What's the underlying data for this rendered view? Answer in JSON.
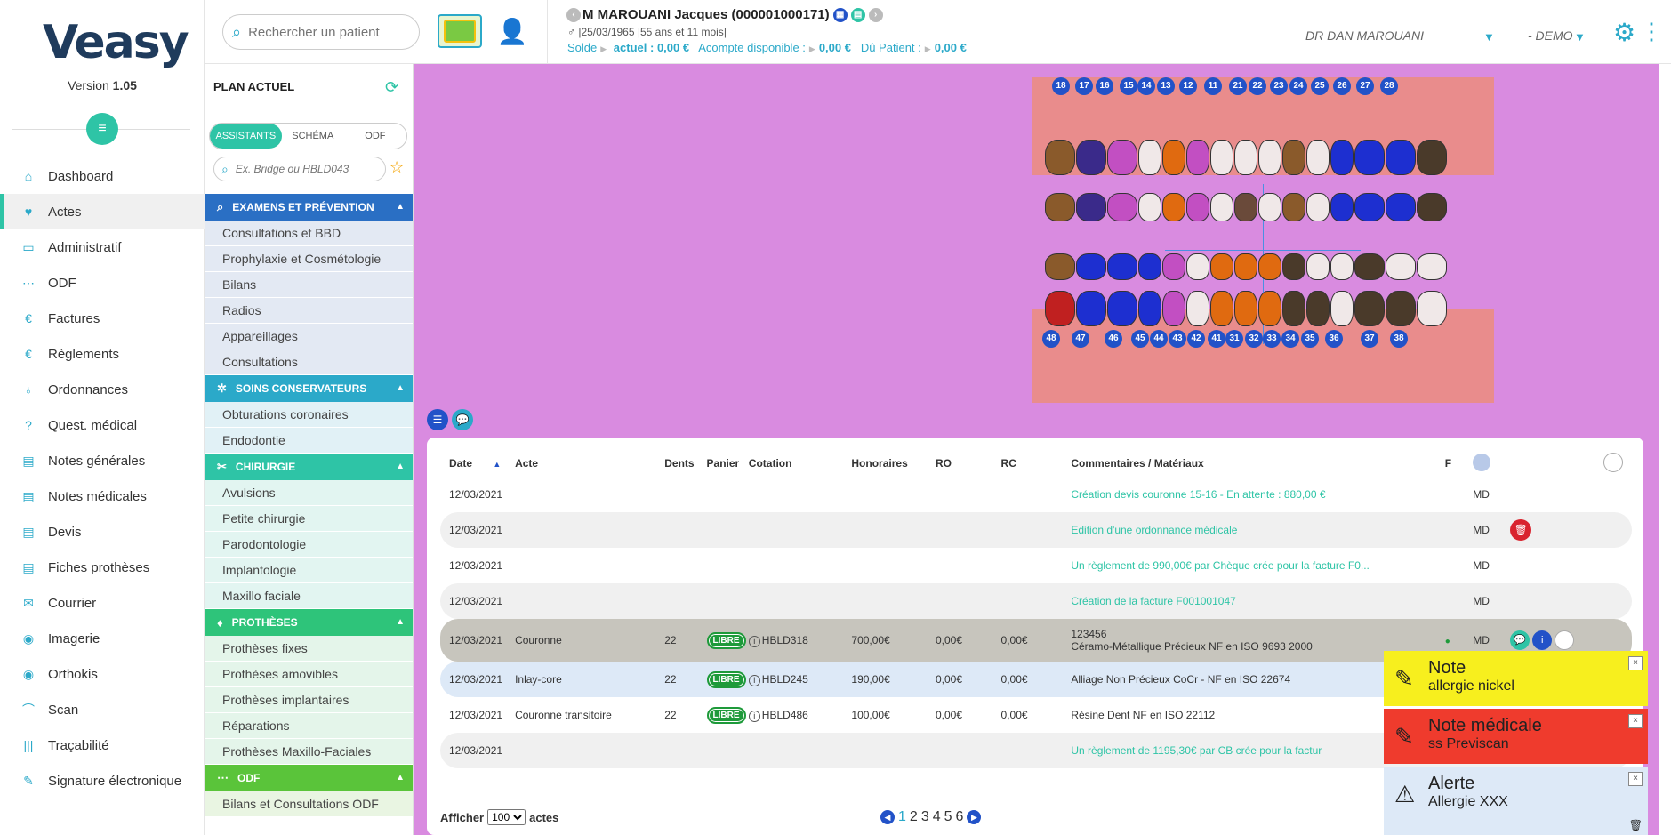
{
  "app": {
    "logo": "Veasy",
    "version_label": "Version",
    "version": "1.05"
  },
  "nav": [
    {
      "label": "Dashboard",
      "icon": "home-icon"
    },
    {
      "label": "Actes",
      "icon": "tooth-icon",
      "active": true
    },
    {
      "label": "Administratif",
      "icon": "id-card-icon"
    },
    {
      "label": "ODF",
      "icon": "braces-icon"
    },
    {
      "label": "Factures",
      "icon": "invoice-icon"
    },
    {
      "label": "Règlements",
      "icon": "euro-icon"
    },
    {
      "label": "Ordonnances",
      "icon": "stethoscope-icon"
    },
    {
      "label": "Quest. médical",
      "icon": "question-icon"
    },
    {
      "label": "Notes générales",
      "icon": "document-icon"
    },
    {
      "label": "Notes médicales",
      "icon": "document-icon"
    },
    {
      "label": "Devis",
      "icon": "document-icon"
    },
    {
      "label": "Fiches prothèses",
      "icon": "document-icon"
    },
    {
      "label": "Courrier",
      "icon": "envelope-icon"
    },
    {
      "label": "Imagerie",
      "icon": "camera-icon"
    },
    {
      "label": "Orthokis",
      "icon": "camera-icon"
    },
    {
      "label": "Scan",
      "icon": "scanner-icon"
    },
    {
      "label": "Traçabilité",
      "icon": "barcode-icon"
    },
    {
      "label": "Signature électronique",
      "icon": "edit-icon"
    }
  ],
  "topbar": {
    "search_placeholder": "Rechercher un patient",
    "patient_name": "M MAROUANI Jacques (000001000171)",
    "patient_birth": "25/03/1965",
    "patient_age": "55 ans et 11 mois",
    "solde_label": "Solde",
    "actuel_label": "actuel :",
    "actuel_value": "0,00 €",
    "acompte_label": "Acompte disponible :",
    "acompte_value": "0,00 €",
    "du_label": "Dû Patient :",
    "du_value": "0,00 €",
    "doctor": "DR DAN MAROUANI",
    "workspace": "- DEMO"
  },
  "plan": {
    "title": "PLAN ACTUEL",
    "tabs": [
      "ASSISTANTS",
      "SCHÉMA",
      "ODF"
    ],
    "search_placeholder": "Ex. Bridge ou HBLD043",
    "sections": [
      {
        "title": "EXAMENS ET PRÉVENTION",
        "icon": "search-icon",
        "color": "#2a6fc4",
        "items_bg": "#e3e9f3",
        "items": [
          "Consultations et BBD",
          "Prophylaxie et Cosmétologie",
          "Bilans",
          "Radios",
          "Appareillages",
          "Consultations"
        ]
      },
      {
        "title": "SOINS CONSERVATEURS",
        "icon": "gear-cluster-icon",
        "color": "#2ba9c9",
        "items_bg": "#e1f1f6",
        "items": [
          "Obturations coronaires",
          "Endodontie"
        ]
      },
      {
        "title": "CHIRURGIE",
        "icon": "scissors-icon",
        "color": "#2ec4a6",
        "items_bg": "#e2f5f1",
        "items": [
          "Avulsions",
          "Petite chirurgie",
          "Parodontologie",
          "Implantologie",
          "Maxillo faciale"
        ]
      },
      {
        "title": "PROTHÈSES",
        "icon": "tooth-icon",
        "color": "#2ec47a",
        "items_bg": "#e4f5ea",
        "items": [
          "Prothèses fixes",
          "Prothèses amovibles",
          "Prothèses implantaires",
          "Réparations",
          "Prothèses Maxillo-Faciales"
        ]
      },
      {
        "title": "ODF",
        "icon": "braces-icon",
        "color": "#5ac43a",
        "items_bg": "#e9f5e2",
        "items": [
          "Bilans et Consultations ODF"
        ]
      }
    ]
  },
  "dental_chart": {
    "upper_numbers": [
      "18",
      "17",
      "16",
      "15",
      "14",
      "13",
      "12",
      "11",
      "21",
      "22",
      "23",
      "24",
      "25",
      "26",
      "27",
      "28"
    ],
    "lower_numbers": [
      "48",
      "47",
      "46",
      "45",
      "44",
      "43",
      "42",
      "41",
      "31",
      "32",
      "33",
      "34",
      "35",
      "36",
      "37",
      "38"
    ]
  },
  "table": {
    "headers": [
      "Date",
      "Acte",
      "Dents",
      "Panier",
      "Cotation",
      "Honoraires",
      "RO",
      "RC",
      "Commentaires / Matériaux",
      "F"
    ],
    "rows": [
      {
        "date": "12/03/2021",
        "acte": "",
        "dents": "",
        "panier": "",
        "cotation": "",
        "hon": "",
        "ro": "",
        "rc": "",
        "comment": "Création devis couronne 15-16 - En attente : 880,00 €",
        "comment2": "",
        "author": "MD",
        "green": true,
        "style": "plain"
      },
      {
        "date": "12/03/2021",
        "acte": "",
        "dents": "",
        "panier": "",
        "cotation": "",
        "hon": "",
        "ro": "",
        "rc": "",
        "comment": "Edition d'une ordonnance médicale",
        "comment2": "",
        "author": "MD",
        "green": true,
        "style": "alt",
        "delete": true
      },
      {
        "date": "12/03/2021",
        "acte": "",
        "dents": "",
        "panier": "",
        "cotation": "",
        "hon": "",
        "ro": "",
        "rc": "",
        "comment": "Un règlement de 990,00€ par Chèque crée pour la facture F0...",
        "comment2": "",
        "author": "MD",
        "green": true,
        "style": "plain"
      },
      {
        "date": "12/03/2021",
        "acte": "",
        "dents": "",
        "panier": "",
        "cotation": "",
        "hon": "",
        "ro": "",
        "rc": "",
        "comment": "Création de la facture F001001047",
        "comment2": "",
        "author": "MD",
        "green": true,
        "style": "alt"
      },
      {
        "date": "12/03/2021",
        "acte": "Couronne",
        "dents": "22",
        "panier": "LIBRE",
        "cotation": "HBLD318",
        "hon": "700,00€",
        "ro": "0,00€",
        "rc": "0,00€",
        "comment": "123456",
        "comment2": "Céramo-Métallique Précieux NF en ISO 9693 2000",
        "author": "MD",
        "green": false,
        "style": "sel",
        "actions": true
      },
      {
        "date": "12/03/2021",
        "acte": "Inlay-core",
        "dents": "22",
        "panier": "LIBRE",
        "cotation": "HBLD245",
        "hon": "190,00€",
        "ro": "0,00€",
        "rc": "0,00€",
        "comment": "Alliage Non Précieux CoCr - NF en ISO 22674",
        "comment2": "",
        "author": "",
        "green": false,
        "style": "blue"
      },
      {
        "date": "12/03/2021",
        "acte": "Couronne transitoire",
        "dents": "22",
        "panier": "LIBRE",
        "cotation": "HBLD486",
        "hon": "100,00€",
        "ro": "0,00€",
        "rc": "0,00€",
        "comment": "Résine Dent NF en ISO 22112",
        "comment2": "",
        "author": "",
        "green": false,
        "style": "plain"
      },
      {
        "date": "12/03/2021",
        "acte": "",
        "dents": "",
        "panier": "",
        "cotation": "",
        "hon": "",
        "ro": "",
        "rc": "",
        "comment": "Un règlement de 1195,30€ par CB crée pour la factur",
        "comment2": "",
        "author": "",
        "green": true,
        "style": "alt"
      }
    ],
    "footer_show": "Afficher",
    "footer_count": "100",
    "footer_unit": "actes",
    "pages": [
      "1",
      "2",
      "3",
      "4",
      "5",
      "6"
    ]
  },
  "notifications": [
    {
      "title": "Note",
      "body": "allergie nickel",
      "color": "#f7ef1e",
      "icon": "pencil-icon"
    },
    {
      "title": "Note médicale",
      "body": "ss Previscan",
      "color": "#ef3b2d",
      "icon": "pencil-icon"
    },
    {
      "title": "Alerte",
      "body": "Allergie XXX",
      "color": "#dde9f7",
      "icon": "warning-icon"
    }
  ],
  "colors": {
    "accent": "#2ec4a6",
    "primary": "#2ba9c9",
    "main_bg": "#d98be0",
    "chart_bg": "#e98c8c"
  }
}
